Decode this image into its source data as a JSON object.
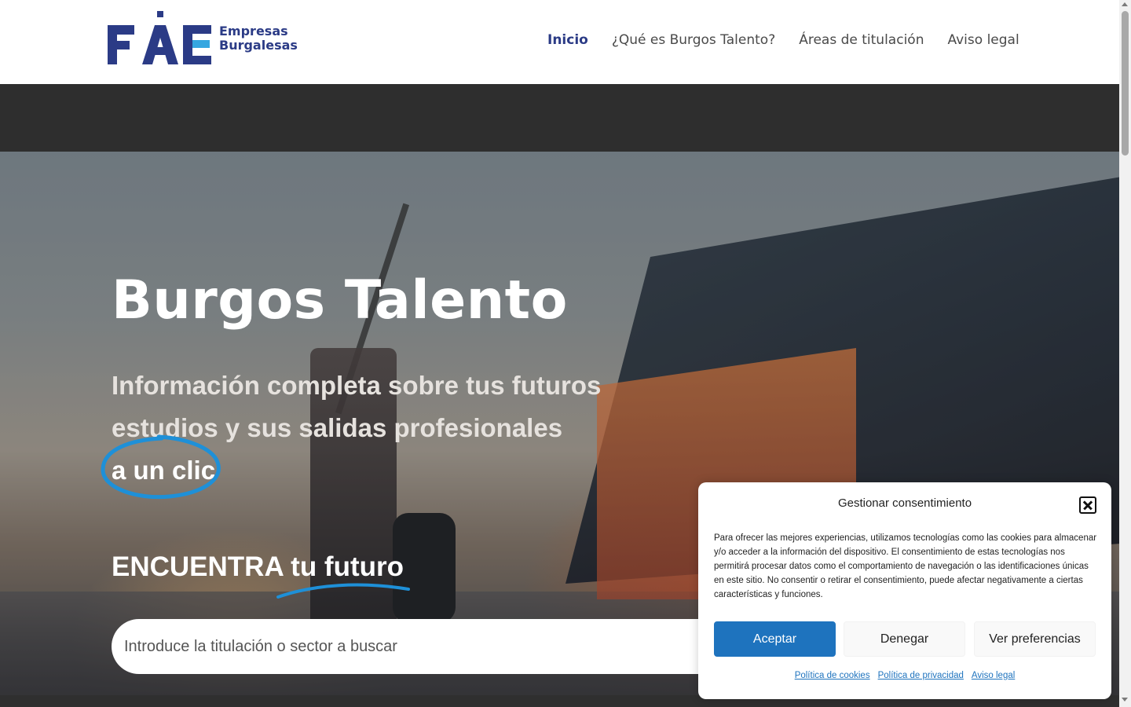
{
  "brand": {
    "logo_line1": "Empresas",
    "logo_line2": "Burgalesas",
    "logo_mark_text": "FAE",
    "color_primary": "#2b3b86",
    "color_accent": "#35a6e0"
  },
  "nav": {
    "items": [
      {
        "label": "Inicio",
        "active": true
      },
      {
        "label": "¿Qué es Burgos Talento?",
        "active": false
      },
      {
        "label": "Áreas de titulación",
        "active": false
      },
      {
        "label": "Aviso legal",
        "active": false
      }
    ]
  },
  "hero": {
    "title": "Burgos  Talento",
    "subtitle": "Información completa sobre tus futuros estudios y sus salidas profesionales",
    "highlight": "a un clic",
    "cta_prefix": "ENCUENTRA",
    "cta_highlight": "tu futuro",
    "highlight_color": "#1e90d8"
  },
  "search": {
    "placeholder": "Introduce la titulación o sector a buscar",
    "value": ""
  },
  "consent": {
    "title": "Gestionar consentimiento",
    "text": "Para ofrecer las mejores experiencias, utilizamos tecnologías como las cookies para almacenar y/o acceder a la información del dispositivo. El consentimiento de estas tecnologías nos permitirá procesar datos como el comportamiento de navegación o las identificaciones únicas en este sitio. No consentir o retirar el consentimiento, puede afectar negativamente a ciertas características y funciones.",
    "accept_label": "Aceptar",
    "deny_label": "Denegar",
    "prefs_label": "Ver preferencias",
    "links": [
      "Política de cookies",
      "Política de privacidad",
      "Aviso legal"
    ],
    "button_color": "#1e73be"
  }
}
